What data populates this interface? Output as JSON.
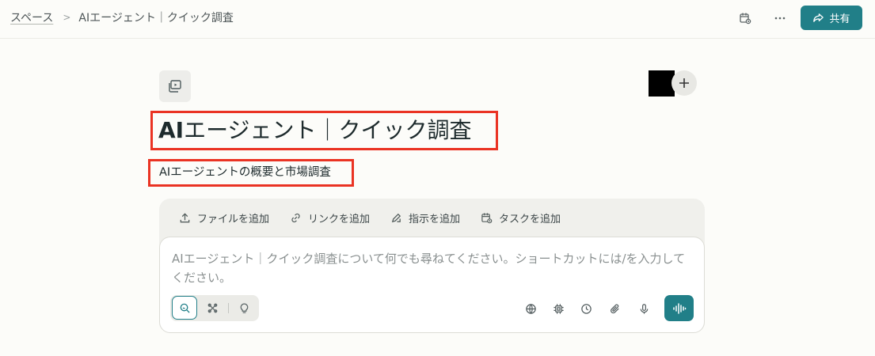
{
  "breadcrumb": {
    "space": "スペース",
    "separator": ">",
    "current": "AIエージェント｜クイック調査"
  },
  "topbar": {
    "share_label": "共有",
    "icons": [
      "calendar-clock-icon",
      "more-icon",
      "share-icon"
    ]
  },
  "page": {
    "title_bold": "AI",
    "title_rest": "エージェント｜クイック調査",
    "description": "AIエージェントの概要と市場調査",
    "space_icon": "space-gallery-icon",
    "add_member_symbol": "+"
  },
  "composer": {
    "actions": [
      {
        "icon": "upload-icon",
        "label": "ファイルを追加"
      },
      {
        "icon": "link-icon",
        "label": "リンクを追加"
      },
      {
        "icon": "edit-icon",
        "label": "指示を追加"
      },
      {
        "icon": "task-calendar-icon",
        "label": "タスクを追加"
      }
    ],
    "placeholder": "AIエージェント｜クイック調査について何でも尋ねてください。ショートカットには/を入力してください。",
    "modes": [
      "search-mode-icon",
      "research-mode-icon",
      "lab-mode-icon"
    ],
    "tools": [
      "globe-icon",
      "chip-icon",
      "clock-icon",
      "attach-icon",
      "microphone-icon",
      "voice-waveform-icon"
    ]
  },
  "colors": {
    "accent": "#217f88",
    "highlight_border": "#ea3323",
    "background": "#fcfcf9"
  }
}
